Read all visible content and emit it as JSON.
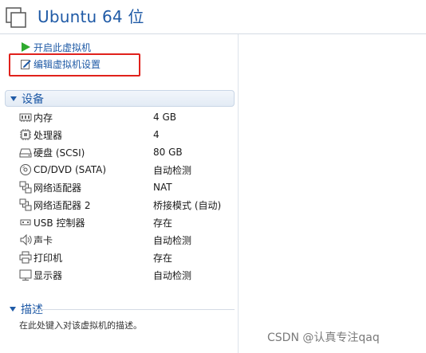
{
  "header": {
    "title": "Ubuntu 64 位",
    "icon": "vm-window-icon"
  },
  "actions": [
    {
      "label": "开启此虚拟机",
      "icon": "play-icon",
      "color": "#2eaa2e"
    },
    {
      "label": "编辑虚拟机设置",
      "icon": "edit-settings-icon"
    }
  ],
  "devices": {
    "title": "设备",
    "items": [
      {
        "name": "内存",
        "value": "4 GB",
        "icon": "memory-icon"
      },
      {
        "name": "处理器",
        "value": "4",
        "icon": "cpu-icon"
      },
      {
        "name": "硬盘 (SCSI)",
        "value": "80 GB",
        "icon": "hard-disk-icon"
      },
      {
        "name": "CD/DVD (SATA)",
        "value": "自动检测",
        "icon": "cd-dvd-icon"
      },
      {
        "name": "网络适配器",
        "value": "NAT",
        "icon": "network-adapter-icon"
      },
      {
        "name": "网络适配器 2",
        "value": "桥接模式 (自动)",
        "icon": "network-adapter-icon"
      },
      {
        "name": "USB 控制器",
        "value": "存在",
        "icon": "usb-icon"
      },
      {
        "name": "声卡",
        "value": "自动检测",
        "icon": "speaker-icon"
      },
      {
        "name": "打印机",
        "value": "存在",
        "icon": "printer-icon"
      },
      {
        "name": "显示器",
        "value": "自动检测",
        "icon": "monitor-icon"
      }
    ]
  },
  "description": {
    "title": "描述",
    "placeholder": "在此处键入对该虚拟机的描述。"
  },
  "watermark": "CSDN @认真专注qaq",
  "colors": {
    "accent": "#1f5aa6",
    "highlight": "#e0211c",
    "play": "#2eaa2e"
  }
}
